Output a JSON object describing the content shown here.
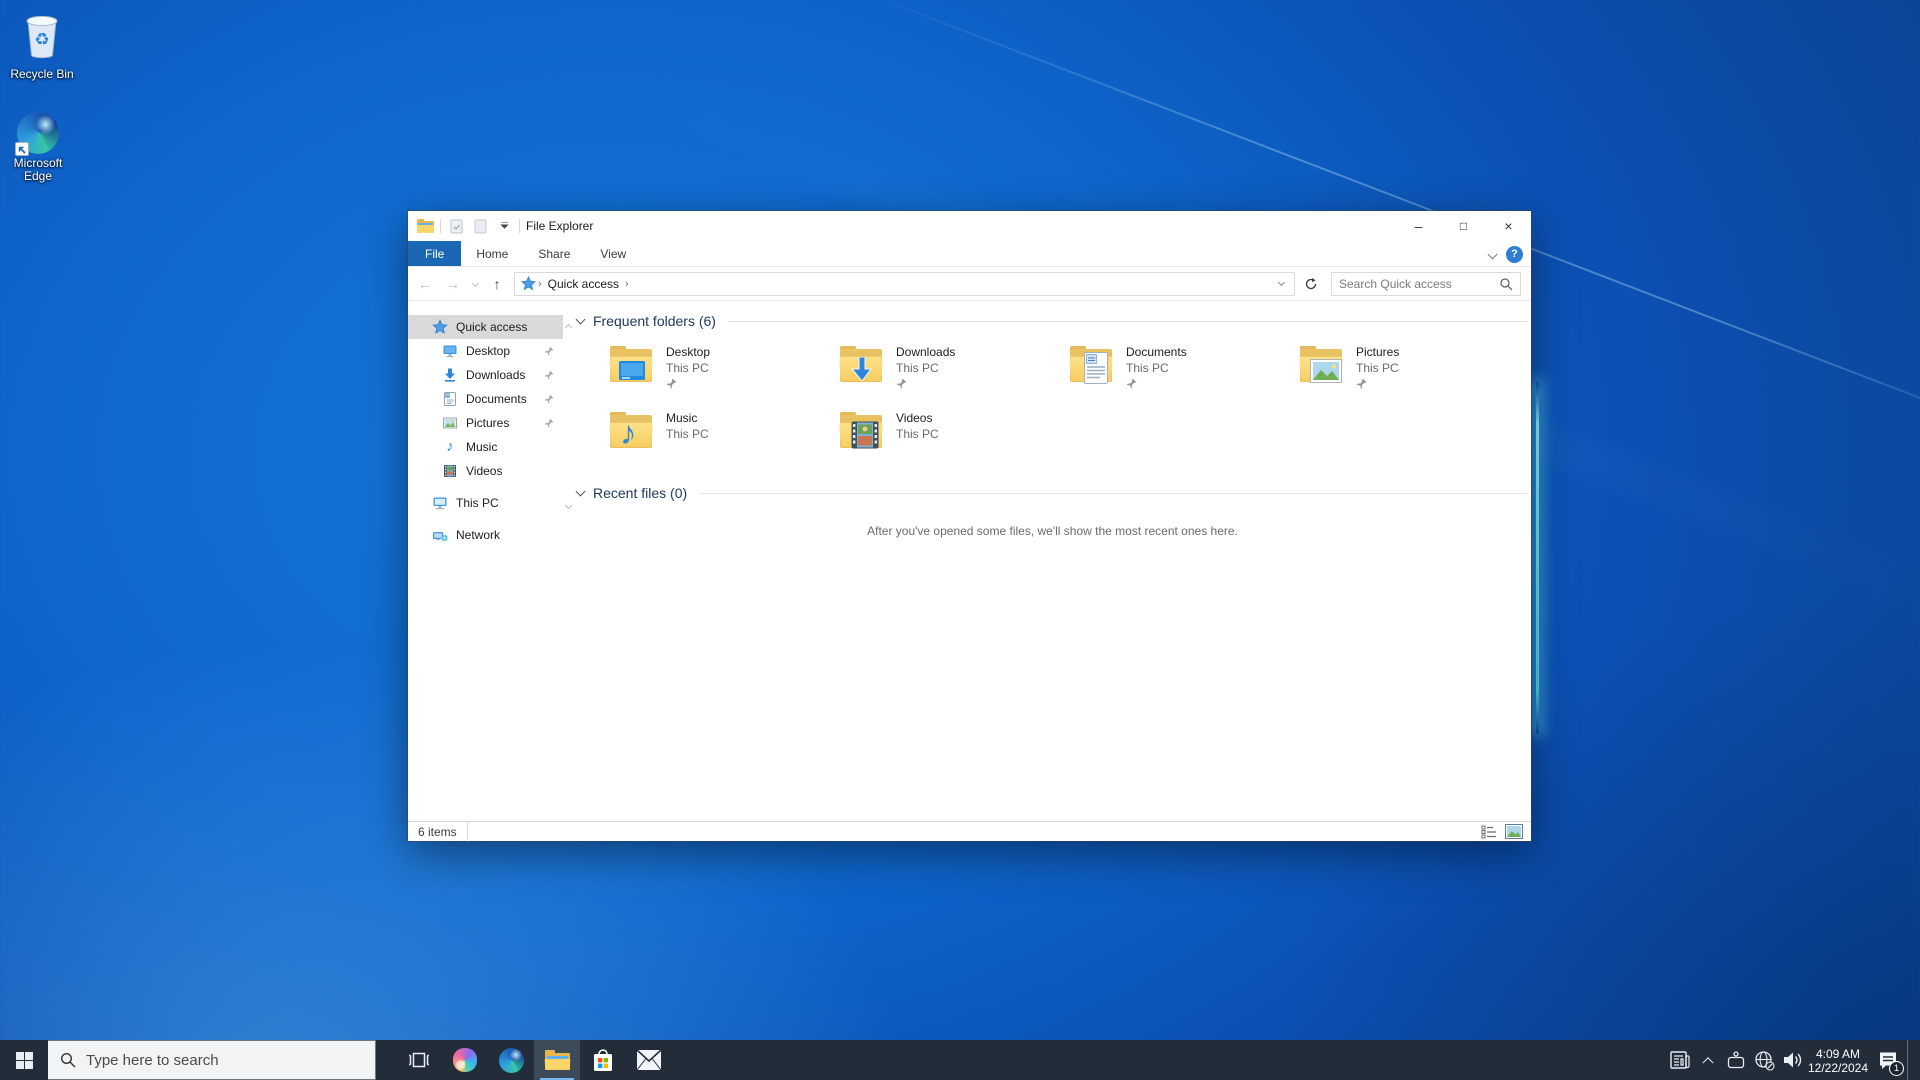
{
  "colors": {
    "file_tab_blue": "#1a68b5",
    "taskbar_dark": "#232d39",
    "sidebar_selection": "#d9d9d9",
    "folder_yellow": "#f6cd62",
    "active_underline_blue": "#76b9f0"
  },
  "desktop": {
    "icons": [
      {
        "label": "Recycle Bin"
      },
      {
        "label": "Microsoft Edge"
      }
    ]
  },
  "explorer": {
    "title": "File Explorer",
    "window_controls": {
      "minimize": "–",
      "maximize": "□",
      "close": "×"
    },
    "ribbon_tabs": [
      {
        "label": "File"
      },
      {
        "label": "Home"
      },
      {
        "label": "Share"
      },
      {
        "label": "View"
      }
    ],
    "ribbon": {
      "help": "?"
    },
    "navigation": {
      "back": "←",
      "forward": "→",
      "up": "↑",
      "breadcrumb_sep": "›",
      "breadcrumb_root": "Quick access",
      "search_placeholder": "Search Quick access"
    },
    "sidebar": {
      "items": [
        {
          "label": "Quick access"
        },
        {
          "label": "Desktop"
        },
        {
          "label": "Downloads"
        },
        {
          "label": "Documents"
        },
        {
          "label": "Pictures"
        },
        {
          "label": "Music"
        },
        {
          "label": "Videos"
        },
        {
          "label": "This PC"
        },
        {
          "label": "Network"
        }
      ]
    },
    "sections": {
      "frequent": {
        "title": "Frequent folders (6)"
      },
      "recent": {
        "title": "Recent files (0)",
        "empty_message": "After you've opened some files, we'll show the most recent ones here."
      }
    },
    "folders": [
      {
        "name": "Desktop",
        "location": "This PC"
      },
      {
        "name": "Downloads",
        "location": "This PC"
      },
      {
        "name": "Documents",
        "location": "This PC"
      },
      {
        "name": "Pictures",
        "location": "This PC"
      },
      {
        "name": "Music",
        "location": "This PC"
      },
      {
        "name": "Videos",
        "location": "This PC"
      }
    ],
    "status_bar": {
      "items_count": "6 items"
    }
  },
  "taskbar": {
    "search_placeholder": "Type here to search",
    "clock": {
      "time": "4:09 AM",
      "date": "12/22/2024"
    },
    "notification_badge": "1"
  }
}
